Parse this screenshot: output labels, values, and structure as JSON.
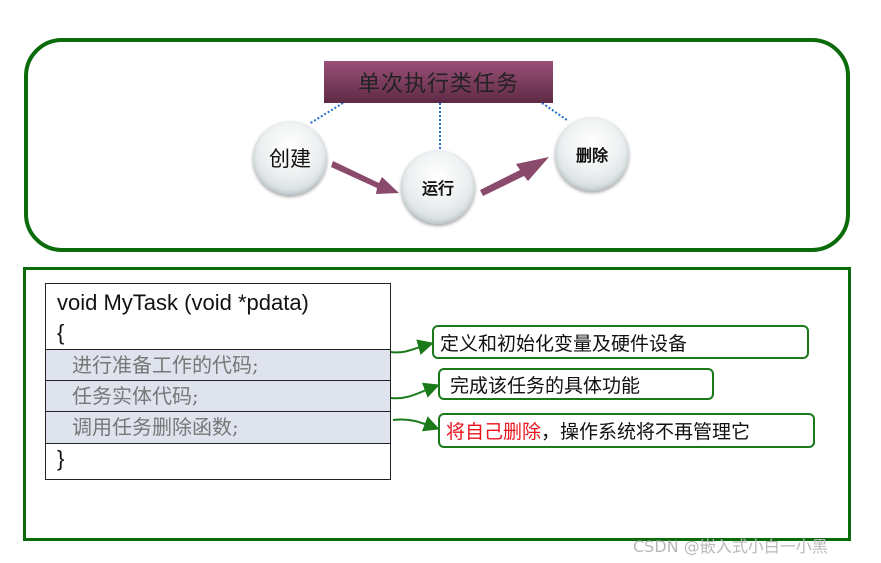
{
  "top_diagram": {
    "title": "单次执行类任务",
    "nodes": [
      {
        "id": "create",
        "label": "创建"
      },
      {
        "id": "run",
        "label": "运行"
      },
      {
        "id": "delete",
        "label": "删除"
      }
    ],
    "colors": {
      "border": "#0b6b0b",
      "title_bg": "#7a3a5c",
      "arrow": "#8a4a6c",
      "dotted_line": "#1f6fd0"
    }
  },
  "code_block": {
    "signature": "void  MyTask (void *pdata)",
    "open_brace": "{",
    "lines": [
      "进行准备工作的代码;",
      "任务实体代码;",
      "调用任务删除函数;"
    ],
    "close_brace": "}"
  },
  "annotations": [
    {
      "text": "定义和初始化变量及硬件设备"
    },
    {
      "text": "完成该任务的具体功能"
    },
    {
      "highlight": "将自己删除",
      "text": "，操作系统将不再管理它"
    }
  ],
  "watermark": "CSDN @嵌入式小白一小黑"
}
